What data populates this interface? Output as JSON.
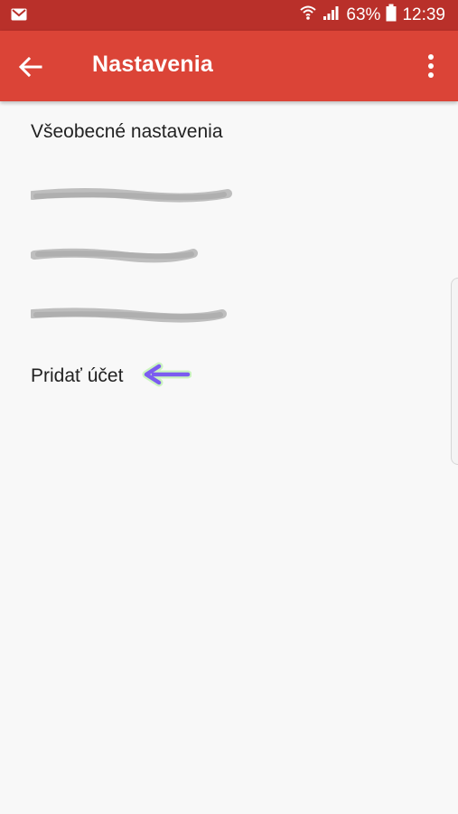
{
  "status_bar": {
    "notification_icon": "gmail-icon",
    "battery_percent": "63%",
    "time": "12:39",
    "icons": [
      "wifi-icon",
      "signal-icon",
      "battery-icon"
    ]
  },
  "app_bar": {
    "title": "Nastavenia",
    "back_icon": "arrow-back-icon",
    "menu_icon": "more-vert-icon",
    "color": "#db4437"
  },
  "settings": {
    "general": "Všeobecné nastavenia",
    "accounts": [
      "",
      "",
      ""
    ],
    "add_account": "Pridať účet"
  },
  "annotation": {
    "arrow_icon": "arrow-left-icon",
    "color": "#7b5cf0"
  }
}
